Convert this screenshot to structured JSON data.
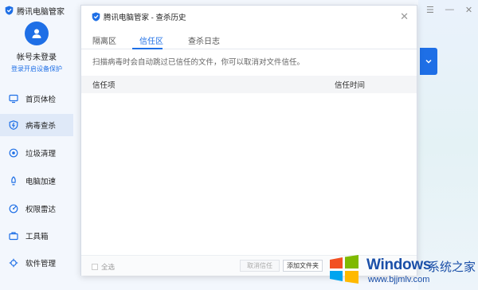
{
  "app": {
    "title": "腾讯电脑管家",
    "account_name": "帐号未登录",
    "login_link": "登录开启设备保护",
    "win_ctrl": [
      "☰",
      "—",
      "✕"
    ]
  },
  "sidebar": {
    "items": [
      {
        "label": "首页体检",
        "icon": "monitor-icon"
      },
      {
        "label": "病毒查杀",
        "icon": "virus-scan-icon",
        "active": true
      },
      {
        "label": "垃圾清理",
        "icon": "cleanup-icon"
      },
      {
        "label": "电脑加速",
        "icon": "rocket-icon"
      },
      {
        "label": "权限雷达",
        "icon": "radar-icon"
      },
      {
        "label": "工具箱",
        "icon": "toolbox-icon"
      },
      {
        "label": "软件管理",
        "icon": "software-icon"
      }
    ]
  },
  "dialog": {
    "title": "腾讯电脑管家 - 查杀历史",
    "close": "✕",
    "tabs": [
      "隔离区",
      "信任区",
      "查杀日志"
    ],
    "active_tab": 1,
    "info_text": "扫描病毒时会自动跳过已信任的文件，你可以取消对文件信任。",
    "table": {
      "columns": [
        "信任项",
        "信任时间"
      ],
      "rows": []
    },
    "footer": {
      "select_all": "全选",
      "cancel_trust": "取消信任",
      "add_folder": "添加文件夹"
    }
  },
  "watermark": {
    "brand": "Windows",
    "site": "系统之家",
    "url": "www.bjjmlv.com"
  },
  "colors": {
    "accent": "#1e6fe6",
    "sidebar_bg": "#f3f7fd",
    "active_nav": "#dfe9f8"
  }
}
